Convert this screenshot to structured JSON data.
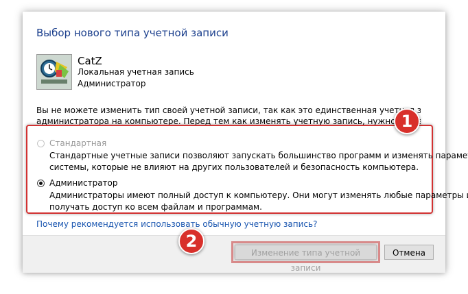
{
  "dialog": {
    "title": "Выбор нового типа учетной записи",
    "account": {
      "name": "CatZ",
      "type": "Локальная учетная запись",
      "role": "Администратор",
      "avatar_icon": "user-avatar-icon"
    },
    "info_lines": [
      "Вы не можете изменить тип своей учетной записи, так как это единственная учетная запись",
      "администратора на компьютере. Перед тем как изменять учетную запись, нужно назначить другого"
    ],
    "options": [
      {
        "label": "Стандартная",
        "selected": false,
        "disabled": true,
        "description_lines": [
          "Стандартные учетные записи позволяют запускать большинство программ и изменять параметры",
          "системы, которые не влияют на других пользователей и безопасность компьютера."
        ]
      },
      {
        "label": "Администратор",
        "selected": true,
        "disabled": false,
        "description_lines": [
          "Администраторы имеют полный доступ к компьютеру. Они могут изменять любые параметры и",
          "получать доступ ко всем файлам и программам."
        ]
      }
    ],
    "help_link": "Почему рекомендуется использовать обычную учетную запись?",
    "buttons": {
      "change": "Изменение типа учетной записи",
      "cancel": "Отмена"
    }
  },
  "markers": [
    "1",
    "2"
  ],
  "colors": {
    "title": "#1a3e8c",
    "link": "#1a56b0",
    "highlight": "#d23232",
    "marker": "#d8302b"
  }
}
